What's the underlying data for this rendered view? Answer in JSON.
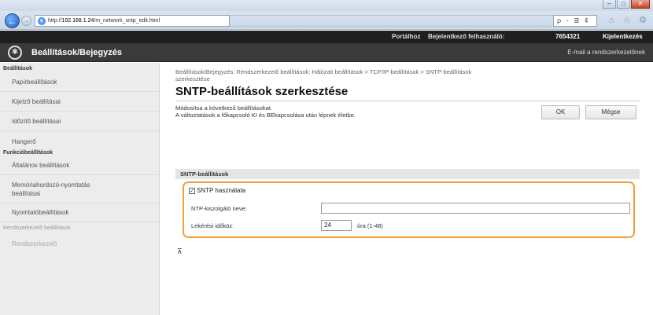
{
  "browser": {
    "url_prefix": "http://",
    "url_host": "192.168.1.24",
    "url_path": "/m_network_sntp_edit.html",
    "search_text": "ρ - ≣ ¢",
    "back_glyph": "←",
    "fwd_glyph": "→",
    "win_min": "–",
    "win_max": "□",
    "win_close": "✕",
    "nav_icons": [
      "⌂",
      "☆",
      "⚙"
    ]
  },
  "header": {
    "portal_link": "Portálhoz",
    "login_label": "Bejelentkező felhasználó:",
    "login_user": "7654321",
    "logout_link": "Kijelentkezés",
    "app_title": "Beállítások/Bejegyzés",
    "mail_link": "E-mail a rendszerkezelőnek"
  },
  "sidebar": {
    "section1": "Beállítások",
    "items1": [
      "Papírbeállítások",
      "Kijelző beállításai",
      "Időzítő beállításai",
      "Hangerő"
    ],
    "section2": "Funkcióbeállítások",
    "items2": [
      "Általános beállítások",
      "Memóriahordozó-nyomtatás",
      "beállításai",
      "Nyomtatóbeállítások"
    ],
    "muted1": "Rendszerkezelő beállítások",
    "muted2": "Rendszerkezelő"
  },
  "main": {
    "breadcrumb_line1": "Beállítások/Bejegyzés: Rendszerkezelő beállítások: Hálózati beállítások > TCP/IP-beállítások > SNTP-beállítások",
    "breadcrumb_line2": "szerkesztése",
    "page_title": "SNTP-beállítások szerkesztése",
    "instructions_line1": "Módosítsa a következő beállításokat.",
    "instructions_line2": "A változtatások a főkapcsoló KI és BEkapcsolása után lépnek életbe.",
    "ok_button": "OK",
    "cancel_button": "Mégse",
    "section_header": "SNTP-beállítások",
    "use_sntp_label": "SNTP használata",
    "use_sntp_checked": true,
    "ntp_server_label": "NTP-kiszolgáló neve:",
    "ntp_server_value": "",
    "interval_label": "Lekérési időköz:",
    "interval_value": "24",
    "interval_unit": "óra (1-48)",
    "to_top_glyph": "⊼"
  },
  "colors": {
    "highlight": "#f0a23a",
    "header_dark": "#1f1f1f",
    "title_bar": "#3a3a3a"
  }
}
